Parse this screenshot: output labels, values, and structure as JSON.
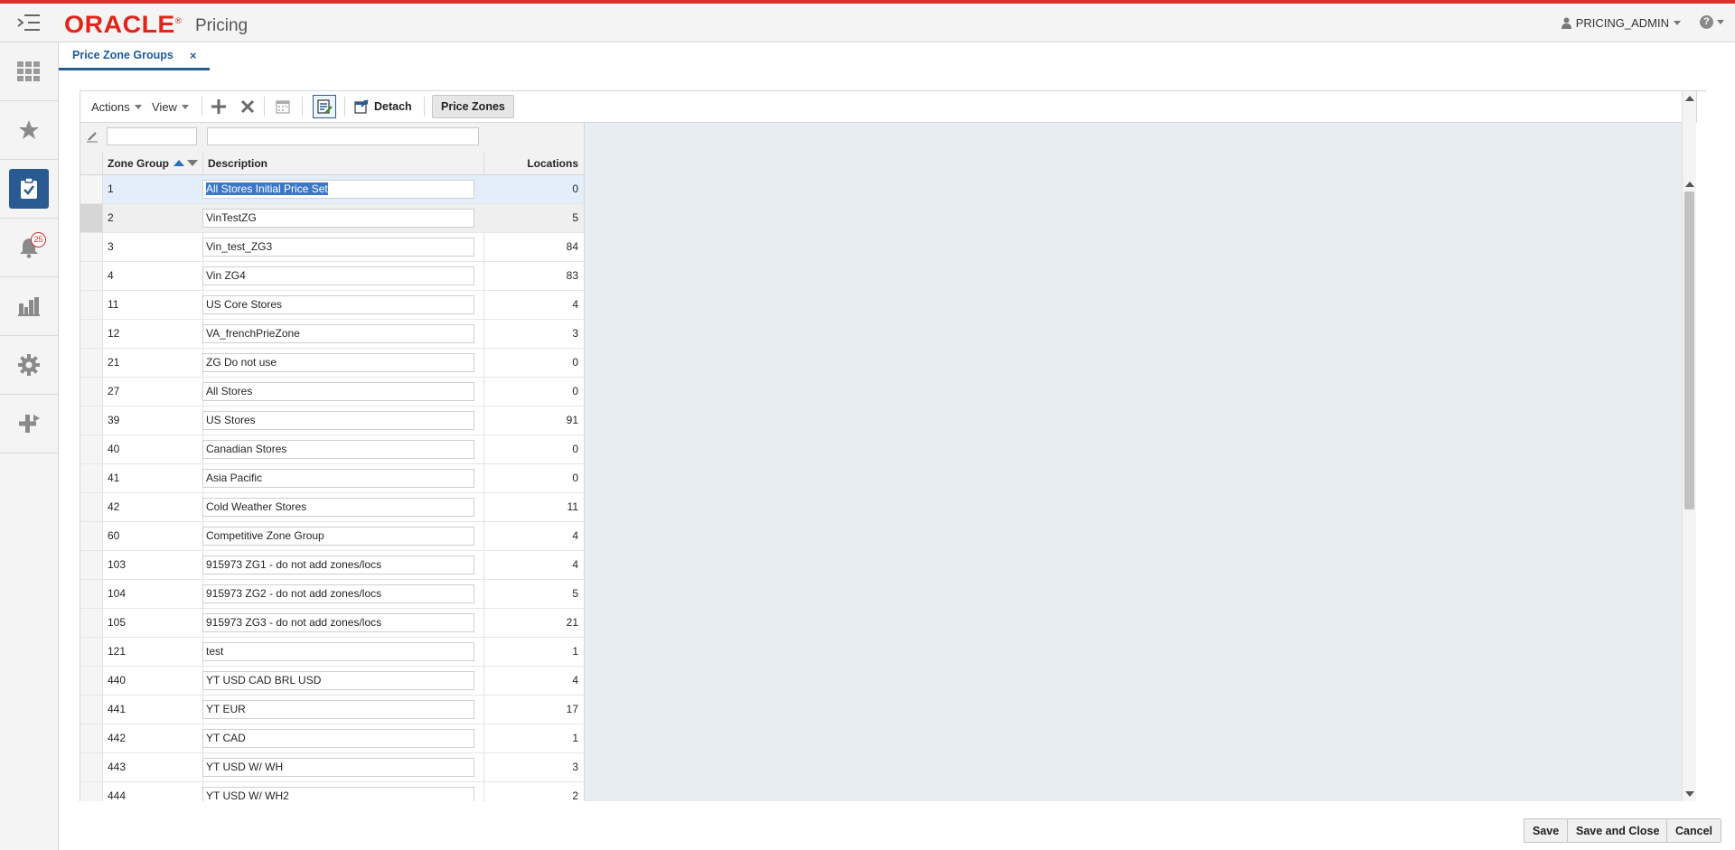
{
  "app": {
    "brand": "ORACLE",
    "brand_mark": "®",
    "name": "Pricing"
  },
  "user": {
    "name": "PRICING_ADMIN"
  },
  "sidebar": {
    "items": [
      {
        "icon": "grid-icon"
      },
      {
        "icon": "star-icon"
      },
      {
        "icon": "clipboard-check-icon",
        "active": true
      },
      {
        "icon": "bell-icon",
        "badge": "25"
      },
      {
        "icon": "bar-chart-icon"
      },
      {
        "icon": "gear-icon"
      },
      {
        "icon": "plus-arrows-icon"
      }
    ]
  },
  "tabs": [
    {
      "label": "Price Zone Groups",
      "close": "×"
    }
  ],
  "toolbar": {
    "actions_label": "Actions",
    "view_label": "View",
    "detach_label": "Detach",
    "price_zones_label": "Price Zones"
  },
  "table": {
    "columns": [
      "Zone Group",
      "Description",
      "Locations"
    ],
    "rows": [
      {
        "zone_group": "1",
        "description": "All Stores Initial Price Set",
        "locations": "0"
      },
      {
        "zone_group": "2",
        "description": "VinTestZG",
        "locations": "5"
      },
      {
        "zone_group": "3",
        "description": "Vin_test_ZG3",
        "locations": "84"
      },
      {
        "zone_group": "4",
        "description": "Vin ZG4",
        "locations": "83"
      },
      {
        "zone_group": "11",
        "description": "US Core Stores",
        "locations": "4"
      },
      {
        "zone_group": "12",
        "description": "VA_frenchPrieZone",
        "locations": "3"
      },
      {
        "zone_group": "21",
        "description": "ZG Do not use",
        "locations": "0"
      },
      {
        "zone_group": "27",
        "description": "All Stores",
        "locations": "0"
      },
      {
        "zone_group": "39",
        "description": "US Stores",
        "locations": "91"
      },
      {
        "zone_group": "40",
        "description": "Canadian Stores",
        "locations": "0"
      },
      {
        "zone_group": "41",
        "description": "Asia Pacific",
        "locations": "0"
      },
      {
        "zone_group": "42",
        "description": "Cold Weather Stores",
        "locations": "11"
      },
      {
        "zone_group": "60",
        "description": "Competitive Zone Group",
        "locations": "4"
      },
      {
        "zone_group": "103",
        "description": "915973 ZG1 - do not add zones/locs",
        "locations": "4"
      },
      {
        "zone_group": "104",
        "description": "915973 ZG2 - do not add zones/locs",
        "locations": "5"
      },
      {
        "zone_group": "105",
        "description": "915973 ZG3 - do not add zones/locs",
        "locations": "21"
      },
      {
        "zone_group": "121",
        "description": "test",
        "locations": "1"
      },
      {
        "zone_group": "440",
        "description": "YT USD CAD BRL USD",
        "locations": "4"
      },
      {
        "zone_group": "441",
        "description": "YT EUR",
        "locations": "17"
      },
      {
        "zone_group": "442",
        "description": "YT CAD",
        "locations": "1"
      },
      {
        "zone_group": "443",
        "description": "YT USD W/ WH",
        "locations": "3"
      },
      {
        "zone_group": "444",
        "description": "YT USD W/ WH2",
        "locations": "2"
      }
    ]
  },
  "footer": {
    "save_label": "Save",
    "save_close_label": "Save and Close",
    "cancel_label": "Cancel"
  },
  "colors": {
    "brand_red": "#e2241b",
    "accent_blue": "#2a5a92",
    "selection": "#3b78c9"
  }
}
